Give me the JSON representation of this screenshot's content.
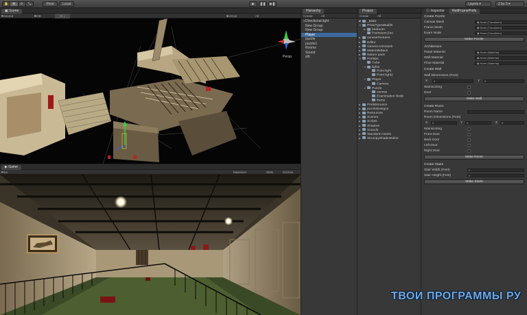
{
  "toolbar": {
    "pivot": "Pivot",
    "local": "Local",
    "layers": "Layers",
    "layout": "2 by 3"
  },
  "scene": {
    "tab": "Scene",
    "shading": "Textured",
    "render_mode": "RGB",
    "gizmos": "Gizmos",
    "all": "All",
    "persp": "Persp"
  },
  "game": {
    "tab": "Game",
    "aspect": "Free Aspect",
    "maximize": "Maximize on Play",
    "stats": "Stats",
    "gizmos": "Gizmos"
  },
  "hierarchy": {
    "tab": "Hierarchy",
    "create": "Create ▾",
    "search_placeholder": "All",
    "items": [
      {
        "label": "Directional light",
        "indent": 0
      },
      {
        "label": "New Group",
        "indent": 0
      },
      {
        "label": "New Group",
        "indent": 0
      },
      {
        "label": "Player",
        "indent": 0,
        "selected": true
      },
      {
        "label": "puzzle",
        "indent": 0
      },
      {
        "label": "puzzle1",
        "indent": 0
      },
      {
        "label": "Rooms",
        "indent": 0
      },
      {
        "label": "Sound",
        "indent": 0
      },
      {
        "label": "stb",
        "indent": 0
      }
    ]
  },
  "project": {
    "tab": "Project",
    "create": "Create ▾",
    "search_placeholder": "All",
    "items": [
      {
        "label": "_Bake",
        "indent": 0,
        "arrow": "▶"
      },
      {
        "label": "ProtoTypesBuilds",
        "indent": 0,
        "arrow": "▼"
      },
      {
        "label": "bedroom",
        "indent": 1,
        "arrow": "▶"
      },
      {
        "label": "PrehistoricZoo",
        "indent": 1,
        "arrow": ""
      },
      {
        "label": "canvasTextures",
        "indent": 0,
        "arrow": "▶"
      },
      {
        "label": "Editor",
        "indent": 0,
        "arrow": "▶"
      },
      {
        "label": "GenericArtAssets",
        "indent": 0,
        "arrow": "▶"
      },
      {
        "label": "MaterialsBack",
        "indent": 0,
        "arrow": "▶"
      },
      {
        "label": "Nature pack",
        "indent": 0,
        "arrow": "▶"
      },
      {
        "label": "Prefabs",
        "indent": 0,
        "arrow": "▼"
      },
      {
        "label": "Cube",
        "indent": 1,
        "arrow": ""
      },
      {
        "label": "lights",
        "indent": 1,
        "arrow": "▼"
      },
      {
        "label": "Point light",
        "indent": 2,
        "arrow": ""
      },
      {
        "label": "Point light2",
        "indent": 2,
        "arrow": ""
      },
      {
        "label": "Player",
        "indent": 1,
        "arrow": "▼"
      },
      {
        "label": "Camera",
        "indent": 2,
        "arrow": ""
      },
      {
        "label": "Puzzle",
        "indent": 1,
        "arrow": "▼"
      },
      {
        "label": "canvas",
        "indent": 2,
        "arrow": ""
      },
      {
        "label": "Examination Node",
        "indent": 2,
        "arrow": ""
      },
      {
        "label": "frame",
        "indent": 2,
        "arrow": ""
      },
      {
        "label": "PrefabSource",
        "indent": 0,
        "arrow": "▶"
      },
      {
        "label": "puzzleDesigns",
        "indent": 0,
        "arrow": "▶"
      },
      {
        "label": "Resources",
        "indent": 0,
        "arrow": "▶"
      },
      {
        "label": "Scenes",
        "indent": 0,
        "arrow": "▶"
      },
      {
        "label": "Scripts",
        "indent": 0,
        "arrow": "▶"
      },
      {
        "label": "Shaders",
        "indent": 0,
        "arrow": "▶"
      },
      {
        "label": "Sounds",
        "indent": 0,
        "arrow": "▶"
      },
      {
        "label": "Standard Assets",
        "indent": 0,
        "arrow": "▶"
      },
      {
        "label": "StrumpyShaderEditor",
        "indent": 0,
        "arrow": "▶"
      }
    ]
  },
  "inspector": {
    "tab": "Inspector",
    "tab2": "RedFramePrefs",
    "create_puzzle": "Create Puzzle",
    "canvas_mesh": "Canvas Mesh",
    "frame_mesh": "Frame Mesh",
    "exam_node": "Exam Node",
    "none_transform": "None (Transform)",
    "make_puzzle": "Make Puzzle",
    "architecture": "Architecture",
    "panel_material": "Panel Material",
    "wall_material": "Wall Material",
    "floor_material": "Floor Material",
    "none_material": "None (Material)",
    "create_wall": "Create Wall",
    "wall_dims": "Wall Dimensions (Feet)",
    "x": "X",
    "y": "Y",
    "z": "Z",
    "zero": "0",
    "wainscoting": "Wainscoting",
    "door": "Door",
    "make_wall": "Make Wall",
    "create_room": "Create Room",
    "room_name": "Room Name",
    "room_dims": "Room Dimensions (Feet)",
    "front_door": "Front Door",
    "back_door": "Back Door",
    "left_door": "Left Door",
    "right_door": "Right Door",
    "make_room": "Make Room",
    "create_stairs": "Create Stairs",
    "stair_width": "Stair Width (Feet)",
    "stair_height": "Stair Height (Feet)",
    "make_stairs": "Make Stairs"
  },
  "watermark": "ТВОИ ПРОГРАММЫ РУ",
  "colors": {
    "selection": "#3d6aa0",
    "scene_bg": "#050505",
    "watermark": "#6fa8e0"
  }
}
